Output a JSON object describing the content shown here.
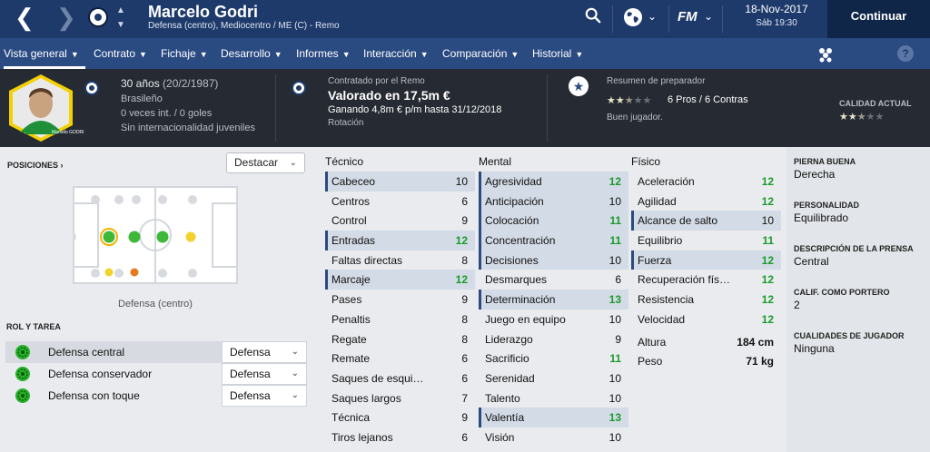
{
  "header": {
    "player_name": "Marcelo Godri",
    "player_sub": "Defensa (centro), Mediocentro / ME (C) - Remo",
    "date": "18-Nov-2017",
    "time": "Sáb 19:30",
    "continue_label": "Continuar",
    "logo_text": "FM",
    "colors": {
      "topbar": "#1e3a6b",
      "tabbar": "#2a4a82",
      "continue": "#102648"
    }
  },
  "tabs": [
    {
      "label": "Vista general",
      "active": true
    },
    {
      "label": "Contrato",
      "active": false
    },
    {
      "label": "Fichaje",
      "active": false
    },
    {
      "label": "Desarrollo",
      "active": false
    },
    {
      "label": "Informes",
      "active": false
    },
    {
      "label": "Interacción",
      "active": false
    },
    {
      "label": "Comparación",
      "active": false
    },
    {
      "label": "Historial",
      "active": false
    }
  ],
  "info": {
    "age": "30 años",
    "dob": "(20/2/1987)",
    "nationality": "Brasileño",
    "caps": "0 veces int. / 0 goles",
    "youth": "Sin internacionalidad juveniles",
    "portrait_caption": "Marcelo GODRI",
    "contract_label": "Contratado por el Remo",
    "value": "Valorado en 17,5m €",
    "wage": "Ganando 4,8m € p/m hasta 31/12/2018",
    "squad_status": "Rotación",
    "report_label": "Resumen de preparador",
    "report_stars": 2.5,
    "pros_cons": "6 Pros / 6 Contras",
    "report_verdict": "Buen jugador.",
    "quality_label": "CALIDAD ACTUAL",
    "quality_stars": 2.5
  },
  "positions": {
    "label": "POSICIONES",
    "highlight_dropdown": "Destacar",
    "caption": "Defensa (centro)"
  },
  "roles": {
    "label": "ROL Y TAREA",
    "items": [
      {
        "name": "Defensa central",
        "duty": "Defensa",
        "selected": true
      },
      {
        "name": "Defensa conservador",
        "duty": "Defensa",
        "selected": false
      },
      {
        "name": "Defensa con toque",
        "duty": "Defensa",
        "selected": false
      }
    ]
  },
  "attributes": {
    "technical": {
      "title": "Técnico",
      "items": [
        {
          "name": "Cabeceo",
          "value": "10",
          "hl": true,
          "green": false
        },
        {
          "name": "Centros",
          "value": "6",
          "hl": false,
          "green": false
        },
        {
          "name": "Control",
          "value": "9",
          "hl": false,
          "green": false
        },
        {
          "name": "Entradas",
          "value": "12",
          "hl": true,
          "green": true
        },
        {
          "name": "Faltas directas",
          "value": "8",
          "hl": false,
          "green": false
        },
        {
          "name": "Marcaje",
          "value": "12",
          "hl": true,
          "green": true
        },
        {
          "name": "Pases",
          "value": "9",
          "hl": false,
          "green": false
        },
        {
          "name": "Penaltis",
          "value": "8",
          "hl": false,
          "green": false
        },
        {
          "name": "Regate",
          "value": "8",
          "hl": false,
          "green": false
        },
        {
          "name": "Remate",
          "value": "6",
          "hl": false,
          "green": false
        },
        {
          "name": "Saques de esqui…",
          "value": "6",
          "hl": false,
          "green": false
        },
        {
          "name": "Saques largos",
          "value": "7",
          "hl": false,
          "green": false
        },
        {
          "name": "Técnica",
          "value": "9",
          "hl": false,
          "green": false
        },
        {
          "name": "Tiros lejanos",
          "value": "6",
          "hl": false,
          "green": false
        }
      ]
    },
    "mental": {
      "title": "Mental",
      "items": [
        {
          "name": "Agresividad",
          "value": "12",
          "hl": true,
          "green": true
        },
        {
          "name": "Anticipación",
          "value": "10",
          "hl": true,
          "green": false
        },
        {
          "name": "Colocación",
          "value": "11",
          "hl": true,
          "green": true
        },
        {
          "name": "Concentración",
          "value": "11",
          "hl": true,
          "green": true
        },
        {
          "name": "Decisiones",
          "value": "10",
          "hl": true,
          "green": false
        },
        {
          "name": "Desmarques",
          "value": "6",
          "hl": false,
          "green": false
        },
        {
          "name": "Determinación",
          "value": "13",
          "hl": true,
          "green": true
        },
        {
          "name": "Juego en equipo",
          "value": "10",
          "hl": false,
          "green": false
        },
        {
          "name": "Liderazgo",
          "value": "9",
          "hl": false,
          "green": false
        },
        {
          "name": "Sacrificio",
          "value": "11",
          "hl": false,
          "green": true
        },
        {
          "name": "Serenidad",
          "value": "10",
          "hl": false,
          "green": false
        },
        {
          "name": "Talento",
          "value": "10",
          "hl": false,
          "green": false
        },
        {
          "name": "Valentía",
          "value": "13",
          "hl": true,
          "green": true
        },
        {
          "name": "Visión",
          "value": "10",
          "hl": false,
          "green": false
        }
      ]
    },
    "physical": {
      "title": "Físico",
      "items": [
        {
          "name": "Aceleración",
          "value": "12",
          "hl": false,
          "green": true
        },
        {
          "name": "Agilidad",
          "value": "12",
          "hl": false,
          "green": true
        },
        {
          "name": "Alcance de salto",
          "value": "10",
          "hl": true,
          "green": false
        },
        {
          "name": "Equilibrio",
          "value": "11",
          "hl": false,
          "green": true
        },
        {
          "name": "Fuerza",
          "value": "12",
          "hl": true,
          "green": true
        },
        {
          "name": "Recuperación fís…",
          "value": "12",
          "hl": false,
          "green": true
        },
        {
          "name": "Resistencia",
          "value": "12",
          "hl": false,
          "green": true
        },
        {
          "name": "Velocidad",
          "value": "12",
          "hl": false,
          "green": true
        }
      ],
      "height_label": "Altura",
      "height": "184 cm",
      "weight_label": "Peso",
      "weight": "71 kg"
    }
  },
  "details": [
    {
      "label": "PIERNA BUENA",
      "value": "Derecha"
    },
    {
      "label": "PERSONALIDAD",
      "value": "Equilibrado"
    },
    {
      "label": "DESCRIPCIÓN DE LA PRENSA",
      "value": "Central"
    },
    {
      "label": "CALIF. COMO PORTERO",
      "value": "2"
    },
    {
      "label": "CUALIDADES DE JUGADOR",
      "value": "Ninguna"
    }
  ]
}
